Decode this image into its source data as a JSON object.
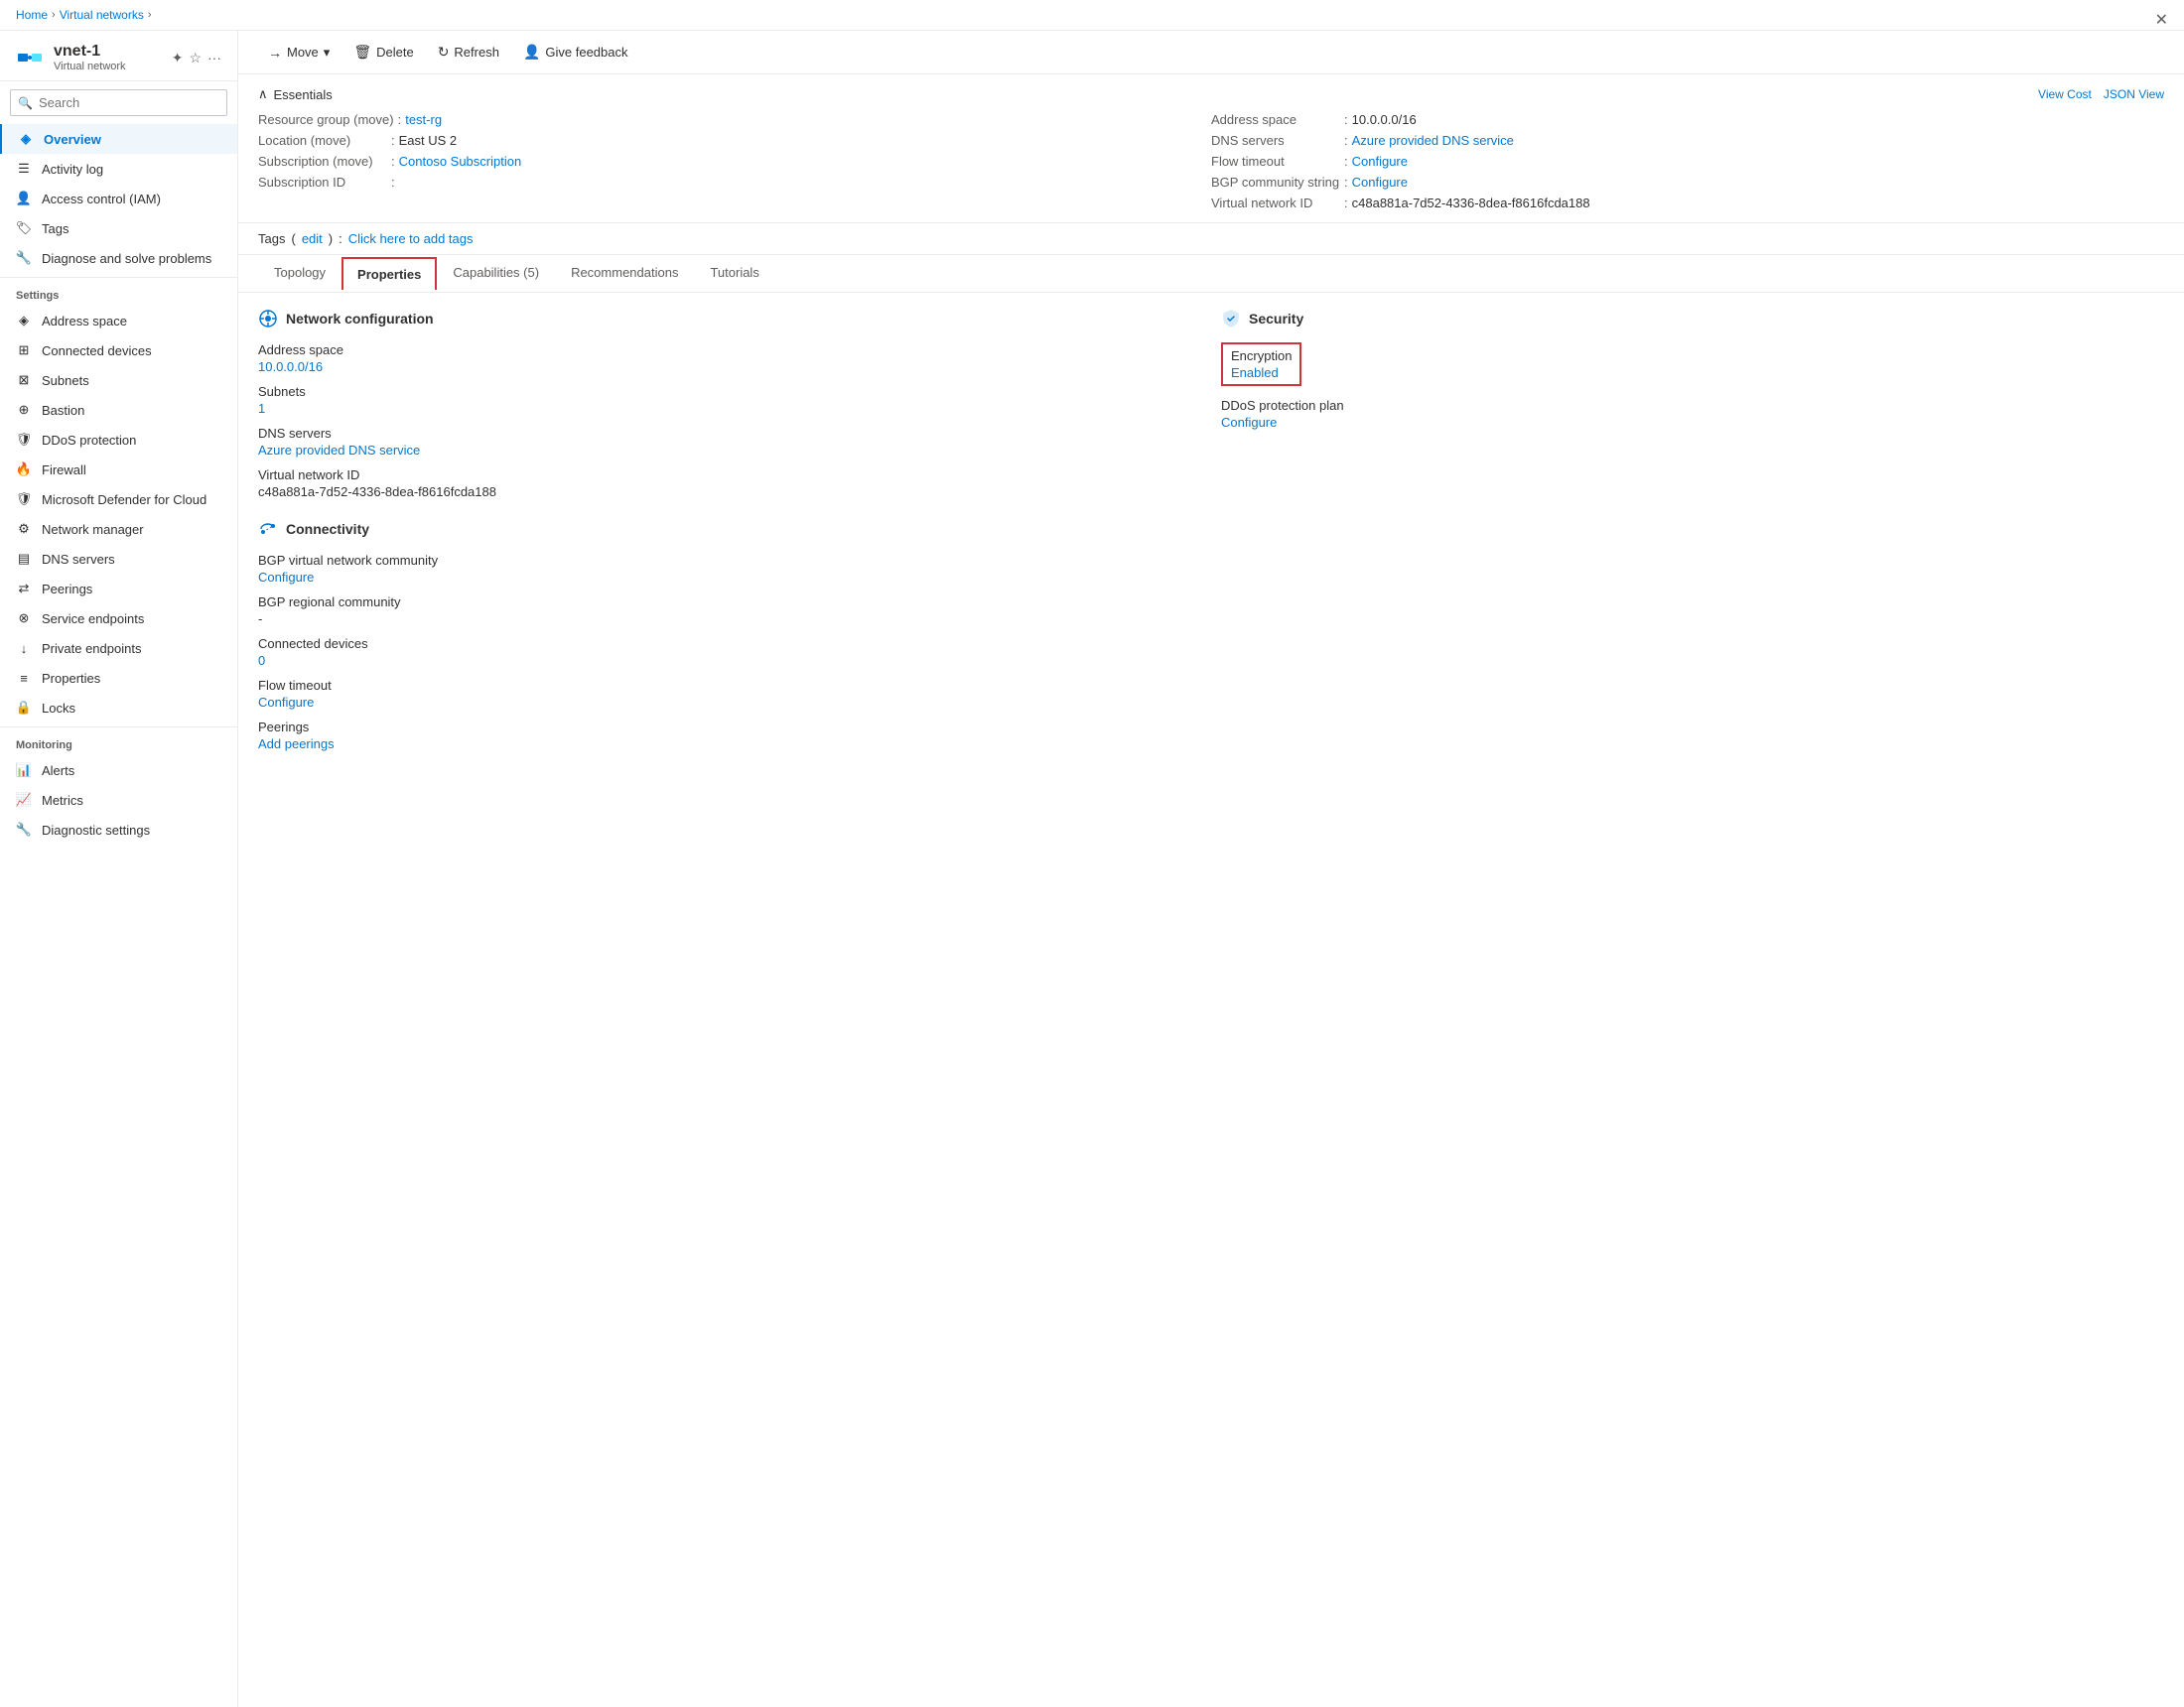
{
  "breadcrumb": {
    "items": [
      "Home",
      "Virtual networks"
    ],
    "separators": [
      ">",
      ">"
    ]
  },
  "sidebar": {
    "resource_name": "vnet-1",
    "resource_type": "Virtual network",
    "search_placeholder": "Search",
    "nav_items": [
      {
        "id": "overview",
        "label": "Overview",
        "icon": "vnet-icon",
        "active": true,
        "section": null
      },
      {
        "id": "activity-log",
        "label": "Activity log",
        "icon": "activity-icon",
        "section": null
      },
      {
        "id": "access-control",
        "label": "Access control (IAM)",
        "icon": "iam-icon",
        "section": null
      },
      {
        "id": "tags",
        "label": "Tags",
        "icon": "tags-icon",
        "section": null
      },
      {
        "id": "diagnose",
        "label": "Diagnose and solve problems",
        "icon": "diagnose-icon",
        "section": null
      },
      {
        "id": "address-space",
        "label": "Address space",
        "icon": "address-icon",
        "section": "Settings"
      },
      {
        "id": "connected-devices",
        "label": "Connected devices",
        "icon": "devices-icon",
        "section": null
      },
      {
        "id": "subnets",
        "label": "Subnets",
        "icon": "subnets-icon",
        "section": null
      },
      {
        "id": "bastion",
        "label": "Bastion",
        "icon": "bastion-icon",
        "section": null
      },
      {
        "id": "ddos-protection",
        "label": "DDoS protection",
        "icon": "ddos-icon",
        "section": null
      },
      {
        "id": "firewall",
        "label": "Firewall",
        "icon": "firewall-icon",
        "section": null
      },
      {
        "id": "ms-defender",
        "label": "Microsoft Defender for Cloud",
        "icon": "defender-icon",
        "section": null
      },
      {
        "id": "network-manager",
        "label": "Network manager",
        "icon": "network-mgr-icon",
        "section": null
      },
      {
        "id": "dns-servers",
        "label": "DNS servers",
        "icon": "dns-icon",
        "section": null
      },
      {
        "id": "peerings",
        "label": "Peerings",
        "icon": "peerings-icon",
        "section": null
      },
      {
        "id": "service-endpoints",
        "label": "Service endpoints",
        "icon": "svc-endpoints-icon",
        "section": null
      },
      {
        "id": "private-endpoints",
        "label": "Private endpoints",
        "icon": "priv-endpoints-icon",
        "section": null
      },
      {
        "id": "properties",
        "label": "Properties",
        "icon": "properties-icon",
        "section": null
      },
      {
        "id": "locks",
        "label": "Locks",
        "icon": "locks-icon",
        "section": null
      },
      {
        "id": "alerts",
        "label": "Alerts",
        "icon": "alerts-icon",
        "section": "Monitoring"
      },
      {
        "id": "metrics",
        "label": "Metrics",
        "icon": "metrics-icon",
        "section": null
      },
      {
        "id": "diagnostic-settings",
        "label": "Diagnostic settings",
        "icon": "diag-settings-icon",
        "section": null
      }
    ]
  },
  "toolbar": {
    "move_label": "Move",
    "delete_label": "Delete",
    "refresh_label": "Refresh",
    "feedback_label": "Give feedback"
  },
  "essentials": {
    "title": "Essentials",
    "view_cost_label": "View Cost",
    "json_view_label": "JSON View",
    "fields_left": [
      {
        "label": "Resource group",
        "value": "test-rg",
        "link": true,
        "extra": "(move)",
        "colon": true
      },
      {
        "label": "Location",
        "value": "East US 2",
        "link": false,
        "extra": "(move)",
        "colon": true
      },
      {
        "label": "Subscription",
        "value": "Contoso Subscription",
        "link": true,
        "extra": "(move)",
        "colon": true
      },
      {
        "label": "Subscription ID",
        "value": "",
        "link": false,
        "extra": "",
        "colon": true
      }
    ],
    "fields_right": [
      {
        "label": "Address space",
        "value": "10.0.0.0/16",
        "link": false,
        "colon": true
      },
      {
        "label": "DNS servers",
        "value": "Azure provided DNS service",
        "link": true,
        "colon": true
      },
      {
        "label": "Flow timeout",
        "value": "Configure",
        "link": true,
        "colon": true
      },
      {
        "label": "BGP community string",
        "value": "Configure",
        "link": true,
        "colon": true
      },
      {
        "label": "Virtual network ID",
        "value": "c48a881a-7d52-4336-8dea-f8616fcda188",
        "link": false,
        "colon": true
      }
    ]
  },
  "tags": {
    "label": "Tags",
    "edit_label": "edit",
    "add_tags_label": "Click here to add tags"
  },
  "tabs": [
    {
      "id": "topology",
      "label": "Topology",
      "active": false
    },
    {
      "id": "properties",
      "label": "Properties",
      "active": true
    },
    {
      "id": "capabilities",
      "label": "Capabilities (5)",
      "active": false
    },
    {
      "id": "recommendations",
      "label": "Recommendations",
      "active": false
    },
    {
      "id": "tutorials",
      "label": "Tutorials",
      "active": false
    }
  ],
  "properties": {
    "network_config": {
      "section_title": "Network configuration",
      "fields": [
        {
          "label": "Address space",
          "value": "10.0.0.0/16",
          "link": true
        },
        {
          "label": "Subnets",
          "value": "1",
          "link": true
        },
        {
          "label": "DNS servers",
          "value": "Azure provided DNS service",
          "link": true
        },
        {
          "label": "Virtual network ID",
          "value": "c48a881a-7d52-4336-8dea-f8616fcda188",
          "link": false
        }
      ]
    },
    "connectivity": {
      "section_title": "Connectivity",
      "fields": [
        {
          "label": "BGP virtual network community",
          "value": "Configure",
          "link": true
        },
        {
          "label": "BGP regional community",
          "value": "-",
          "link": false
        },
        {
          "label": "Connected devices",
          "value": "0",
          "link": true
        },
        {
          "label": "Flow timeout",
          "value": "Configure",
          "link": true
        },
        {
          "label": "Peerings",
          "value": "Add peerings",
          "link": true
        }
      ]
    },
    "security": {
      "section_title": "Security",
      "encryption_label": "Encryption",
      "encryption_value": "Enabled",
      "ddos_label": "DDoS protection plan",
      "ddos_value": "Configure",
      "ddos_link": true
    }
  }
}
